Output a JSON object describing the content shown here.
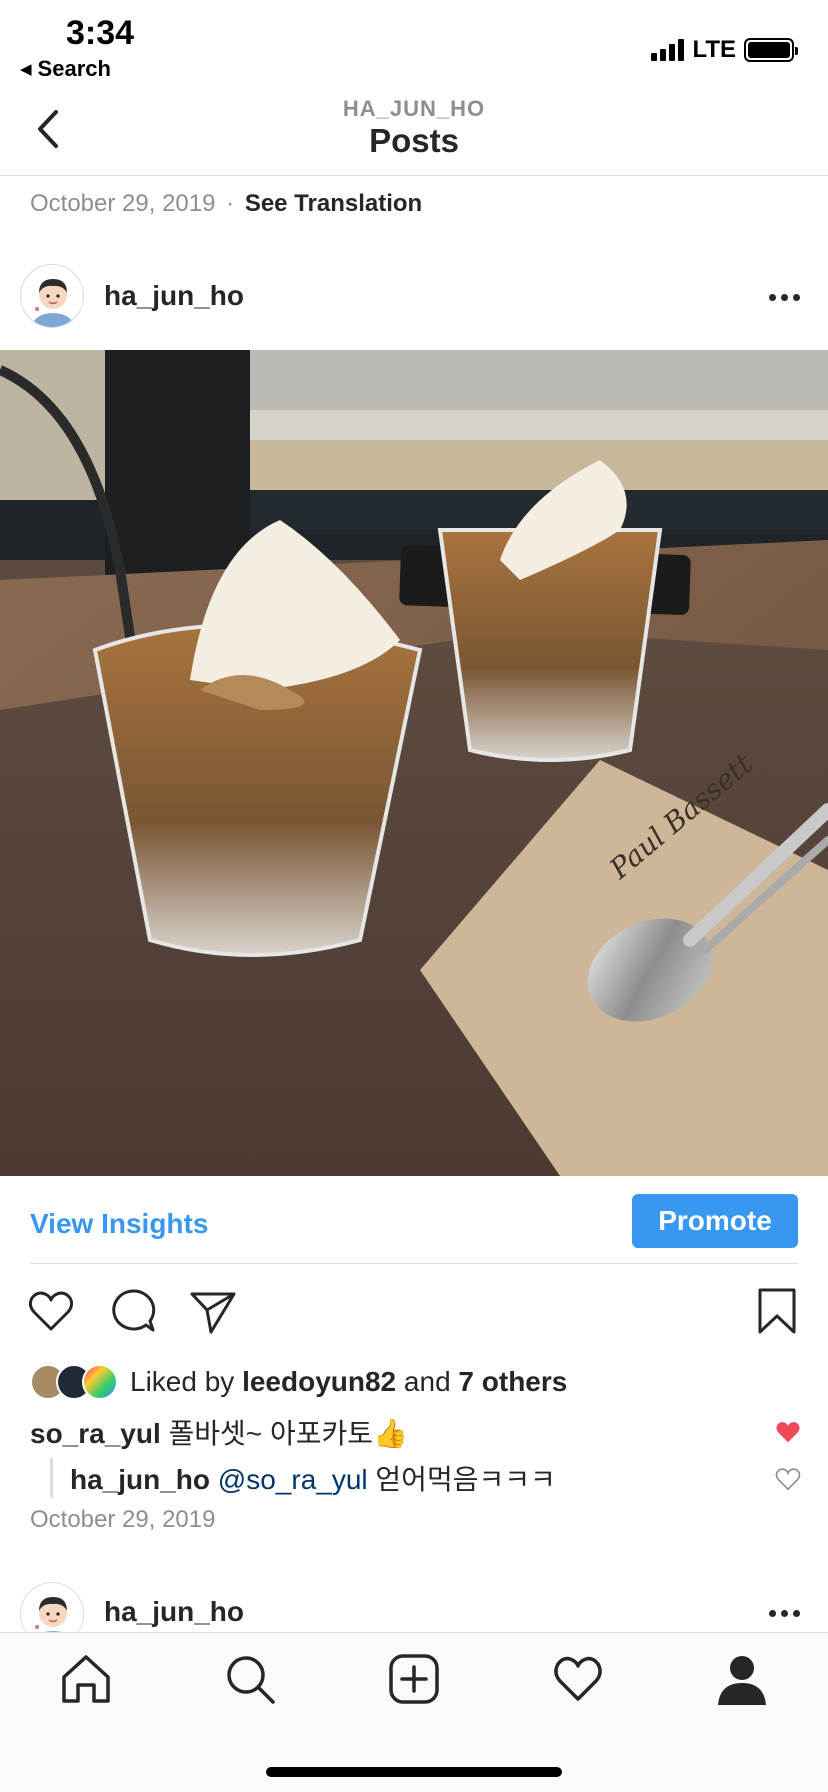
{
  "status_bar": {
    "time": "3:34",
    "back_app": "Search",
    "network": "LTE"
  },
  "nav": {
    "subtitle": "HA_JUN_HO",
    "title": "Posts"
  },
  "prev_post": {
    "date": "October 29, 2019",
    "separator": "·",
    "translation": "See Translation"
  },
  "post": {
    "username": "ha_jun_ho",
    "view_insights": "View Insights",
    "promote": "Promote",
    "likes": {
      "prefix": "Liked by",
      "first_liker": "leedoyun82",
      "and": "and",
      "others": "7 others"
    },
    "comments": [
      {
        "user": "so_ra_yul",
        "text": "폴바셋~ 아포카토👍",
        "liked": true
      },
      {
        "user": "ha_jun_ho",
        "mention": "@so_ra_yul",
        "text": "얻어먹음ㅋㅋㅋ",
        "liked": false
      }
    ],
    "date": "October 29, 2019"
  },
  "next_post": {
    "username": "ha_jun_ho"
  },
  "colors": {
    "accent": "#3897f0",
    "heart_red": "#ed4956",
    "mention": "#003569",
    "muted": "#8e8e8e"
  },
  "icons": {
    "actions": [
      "heart-icon",
      "comment-icon",
      "share-icon",
      "bookmark-icon"
    ],
    "tabs": [
      "home-icon",
      "search-icon",
      "add-post-icon",
      "activity-heart-icon",
      "profile-icon"
    ]
  }
}
